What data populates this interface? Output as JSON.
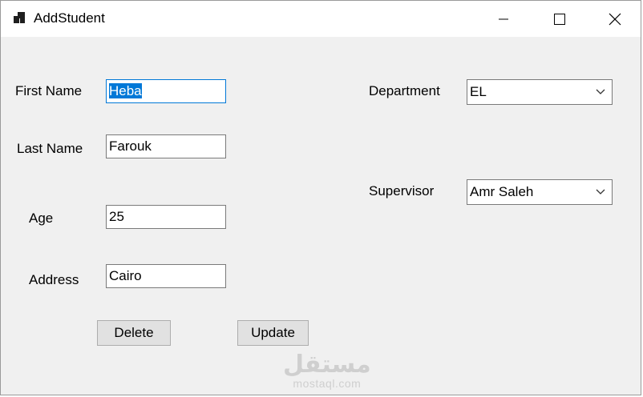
{
  "window": {
    "title": "AddStudent"
  },
  "form": {
    "first_name": {
      "label": "First Name",
      "value": "Heba"
    },
    "last_name": {
      "label": "Last Name",
      "value": "Farouk"
    },
    "age": {
      "label": "Age",
      "value": "25"
    },
    "address": {
      "label": "Address",
      "value": "Cairo"
    },
    "department": {
      "label": "Department",
      "value": "EL"
    },
    "supervisor": {
      "label": "Supervisor",
      "value": "Amr Saleh"
    }
  },
  "buttons": {
    "delete_label": "Delete",
    "update_label": "Update"
  },
  "watermark": {
    "arabic": "مستقل",
    "latin": "mostaql.com"
  },
  "colors": {
    "accent": "#0078d7",
    "form_background": "#f0f0f0",
    "button_background": "#e1e1e1"
  },
  "icons": {
    "app": "app-window-icon",
    "minimize": "minimize-icon",
    "maximize": "maximize-icon",
    "close": "close-icon",
    "dropdown": "chevron-down-icon"
  }
}
